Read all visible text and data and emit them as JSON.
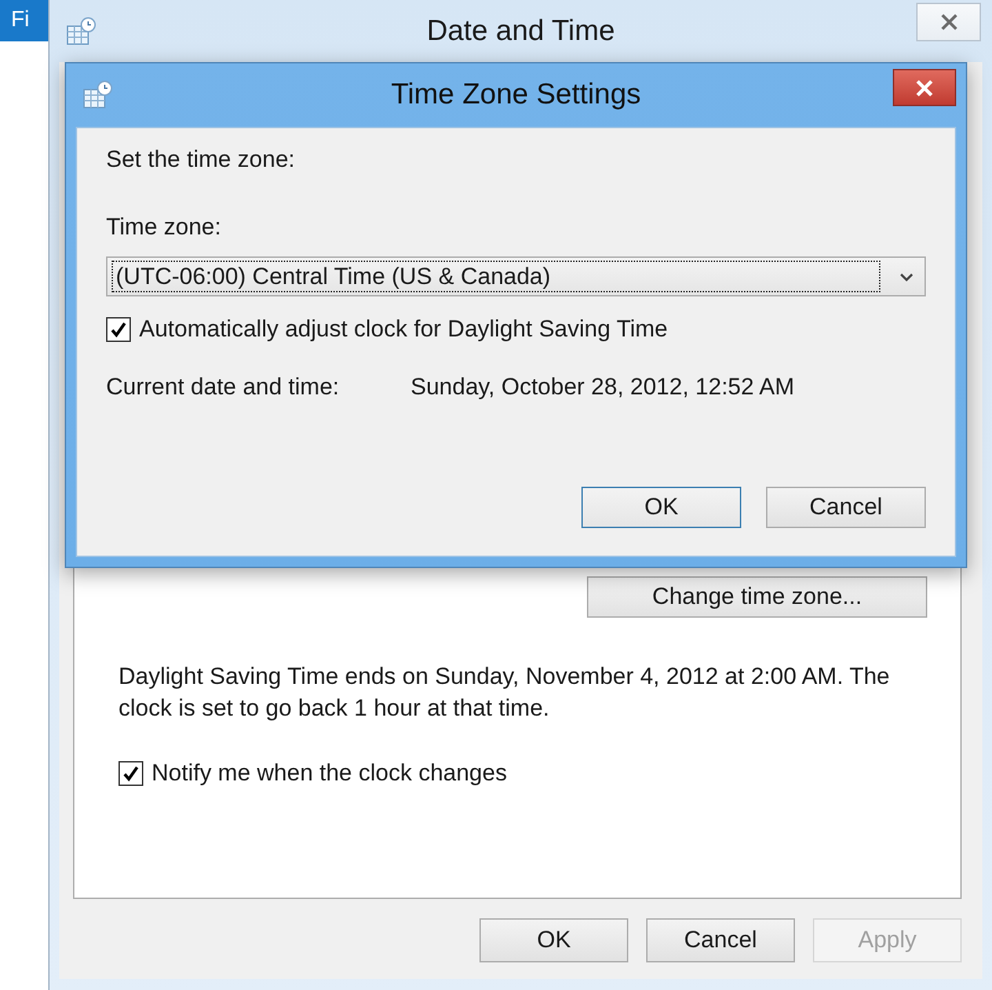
{
  "background_app": {
    "tab": {
      "label": "Fi"
    }
  },
  "window": {
    "title": "Date and Time"
  },
  "dialog": {
    "title": "Time Zone Settings",
    "intro": "Set the time zone:",
    "time_zone": {
      "label": "Time zone:",
      "value": "(UTC-06:00) Central Time (US & Canada)",
      "focused": true
    },
    "dst_checkbox": {
      "label": "Automatically adjust clock for Daylight Saving Time",
      "checked": true
    },
    "current": {
      "label": "Current date and time:",
      "value": "Sunday, October 28, 2012, 12:52 AM"
    },
    "buttons": [
      {
        "label": "OK",
        "default": true
      },
      {
        "label": "Cancel",
        "default": false
      }
    ]
  },
  "panel": {
    "button": {
      "label": "Change time zone..."
    },
    "dst_notice": "Daylight Saving Time ends on Sunday, November 4, 2012 at 2:00 AM. The clock is set to go back 1 hour at that time.",
    "notify_checkbox": {
      "label": "Notify me when the clock changes",
      "checked": true
    }
  },
  "buttons": [
    {
      "label": "OK",
      "disabled": false
    },
    {
      "label": "Cancel",
      "disabled": false
    },
    {
      "label": "Apply",
      "disabled": true
    }
  ]
}
